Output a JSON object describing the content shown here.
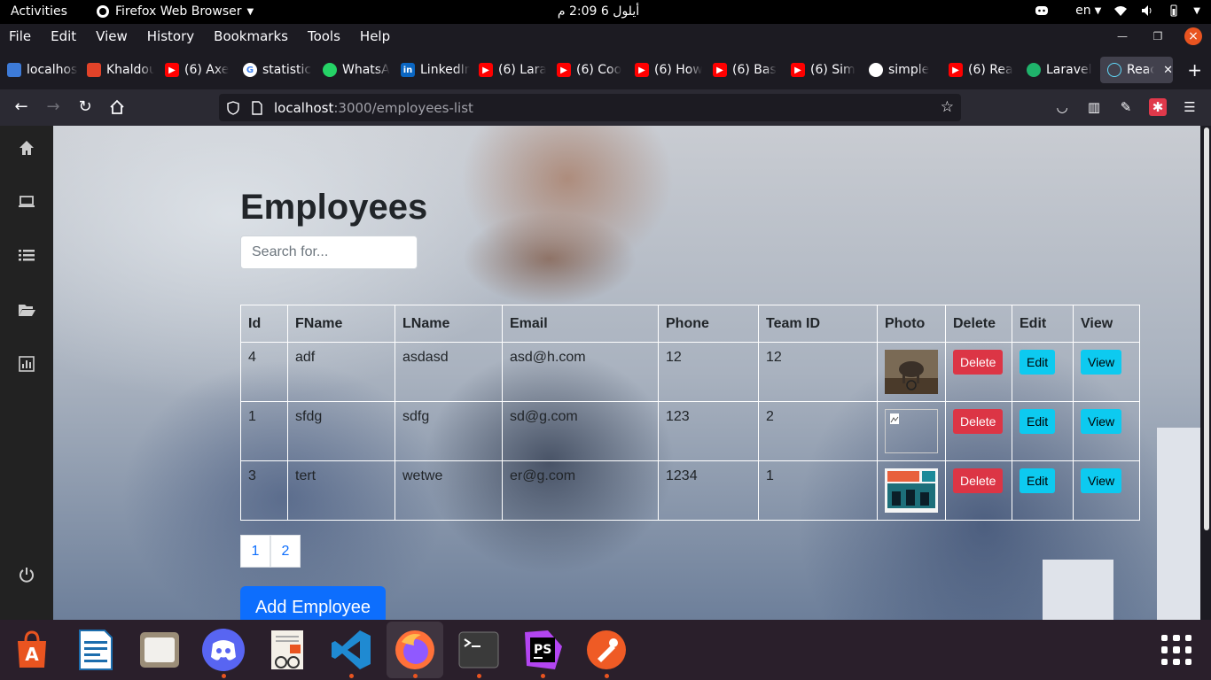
{
  "topbar": {
    "activities": "Activities",
    "app_name": "Firefox Web Browser",
    "clock_time": "2:09",
    "clock_suffix": "م",
    "clock_date": "أيلول 6",
    "language": "en"
  },
  "menubar": {
    "items": [
      "File",
      "Edit",
      "View",
      "History",
      "Bookmarks",
      "Tools",
      "Help"
    ]
  },
  "tabs": [
    {
      "title": "localhost",
      "icon": "multi-site-icon",
      "color": "#3d7bd8"
    },
    {
      "title": "Khaldoun",
      "icon": "gitlab-icon",
      "color": "#e24329"
    },
    {
      "title": "(6) Axe",
      "icon": "youtube-icon",
      "color": "#ff0000"
    },
    {
      "title": "statistics",
      "icon": "google-icon",
      "color": "#4285f4"
    },
    {
      "title": "WhatsApp",
      "icon": "whatsapp-icon",
      "color": "#25d366"
    },
    {
      "title": "LinkedIn",
      "icon": "linkedin-icon",
      "color": "#0a66c2"
    },
    {
      "title": "(6) Lara",
      "icon": "youtube-icon",
      "color": "#ff0000"
    },
    {
      "title": "(6) Coo",
      "icon": "youtube-icon",
      "color": "#ff0000"
    },
    {
      "title": "(6) How",
      "icon": "youtube-icon",
      "color": "#ff0000"
    },
    {
      "title": "(6) Bas",
      "icon": "youtube-icon",
      "color": "#ff0000"
    },
    {
      "title": "(6) Sim",
      "icon": "youtube-icon",
      "color": "#ff0000"
    },
    {
      "title": "simple",
      "icon": "github-icon",
      "color": "#ffffff"
    },
    {
      "title": "(6) Rea",
      "icon": "youtube-icon",
      "color": "#ff0000"
    },
    {
      "title": "Laravel",
      "icon": "laravel-icon",
      "color": "#1fb36b"
    },
    {
      "title": "React",
      "icon": "react-icon",
      "color": "#61dafb"
    }
  ],
  "url": {
    "host": "localhost",
    "path": ":3000/employees-list"
  },
  "page": {
    "title": "Employees",
    "search_placeholder": "Search for...",
    "columns": [
      "Id",
      "FName",
      "LName",
      "Email",
      "Phone",
      "Team ID",
      "Photo",
      "Delete",
      "Edit",
      "View"
    ],
    "rows": [
      {
        "id": "4",
        "fname": "adf",
        "lname": "asdasd",
        "email": "asd@h.com",
        "phone": "12",
        "team": "12",
        "photo": "elephant-photo"
      },
      {
        "id": "1",
        "fname": "sfdg",
        "lname": "sdfg",
        "email": "sd@g.com",
        "phone": "123",
        "team": "2",
        "photo": "broken-image"
      },
      {
        "id": "3",
        "fname": "tert",
        "lname": "wetwe",
        "email": "er@g.com",
        "phone": "1234",
        "team": "1",
        "photo": "book-cover-photo"
      }
    ],
    "delete_label": "Delete",
    "edit_label": "Edit",
    "view_label": "View",
    "pages": [
      "1",
      "2"
    ],
    "add_label": "Add Employee"
  },
  "dock": [
    "app-center-icon",
    "writer-icon",
    "files-icon",
    "discord-icon",
    "document-viewer-icon",
    "vscode-icon",
    "firefox-icon",
    "terminal-icon",
    "phpstorm-icon",
    "postman-icon"
  ]
}
